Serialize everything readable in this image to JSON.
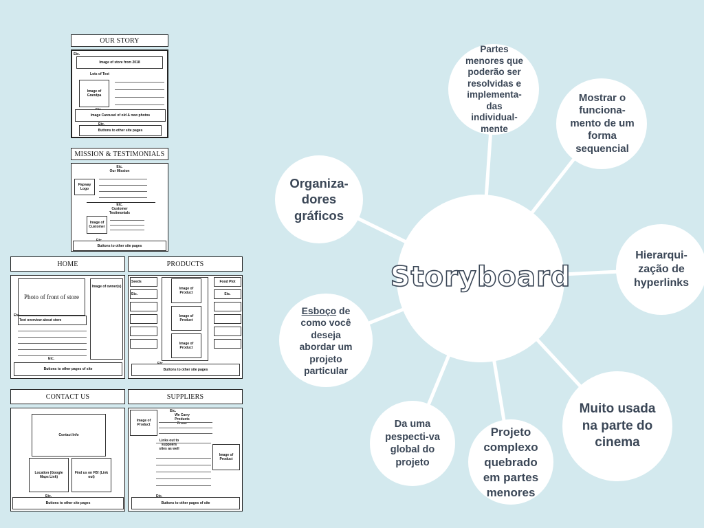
{
  "wireframes": {
    "our_story": {
      "title": "OUR STORY",
      "etc": "Etc.",
      "image_store": "Image of store from 2018",
      "lots_text": "Lots of Text",
      "image_grandpa": "Image of Grandpa",
      "carousel": "Image Carousel of old & new photos",
      "etc2": "Etc.",
      "footer_etc": "Etc.",
      "footer": "Buttons to other site pages"
    },
    "mission": {
      "title": "MISSION & TESTIMONIALS",
      "etc": "Etc.",
      "our_mission": "Our Mission",
      "logo": "Papway Logo",
      "etc2": "Etc.",
      "testimonials": "Customer Testimonials",
      "image_customer": "Image of Customer",
      "footer_etc": "Etc.",
      "footer": "Buttons to other site pages"
    },
    "home": {
      "title": "HOME",
      "photo": "Photo of front of store",
      "image_owners": "Image of owner(s)",
      "etc": "Etc.",
      "overview": "Text overview about store",
      "etc2": "Etc.",
      "footer": "Buttons to other pages of site"
    },
    "products": {
      "title": "PRODUCTS",
      "seeds": "Seeds",
      "food_plot": "Food Plot",
      "etc_left": "Etc.",
      "etc_right": "Etc.",
      "image1": "Image of Product",
      "image2": "Image of Product",
      "image3": "Image of Product",
      "footer_etc": "Etc.",
      "footer": "Buttons to other site pages"
    },
    "contact": {
      "title": "CONTACT US",
      "info": "Contact Info",
      "location": "Location (Google Maps Link)",
      "fb": "Find us on FB! (Link out)",
      "footer_etc": "Etc.",
      "footer": "Buttons to other site pages"
    },
    "suppliers": {
      "title": "SUPPLIERS",
      "image_left": "Image of Product",
      "etc": "Etc.",
      "carry": "We Carry Products From-",
      "links": "Links out to suppliers sites as well",
      "image_right": "Image of Product",
      "footer_etc": "Etc.",
      "footer": "Buttons to other pages of site"
    }
  },
  "mindmap": {
    "center": "Storyboard",
    "nodes": [
      {
        "id": "partes",
        "text": "Partes menores que poderão ser resolvidas e implementa-das individual-mente"
      },
      {
        "id": "mostrar",
        "text": "Mostrar o funciona-mento de um forma sequencial"
      },
      {
        "id": "organiza",
        "text": "Organiza-dores gráficos"
      },
      {
        "id": "hierarqui",
        "text": "Hierarqui-zação de hyperlinks"
      },
      {
        "id": "esboco_word",
        "text": "Esboço"
      },
      {
        "id": "esboco_rest",
        "text": " de como você deseja abordar um projeto particular"
      },
      {
        "id": "muito",
        "text": "Muito usada na parte do cinema"
      },
      {
        "id": "visao",
        "text": "Da uma pespecti-va global do projeto"
      },
      {
        "id": "projeto",
        "text": "Projeto complexo quebrado em partes menores"
      }
    ]
  },
  "colors": {
    "background": "#d3e9ee",
    "node": "#ffffff",
    "text": "#3a4656"
  }
}
